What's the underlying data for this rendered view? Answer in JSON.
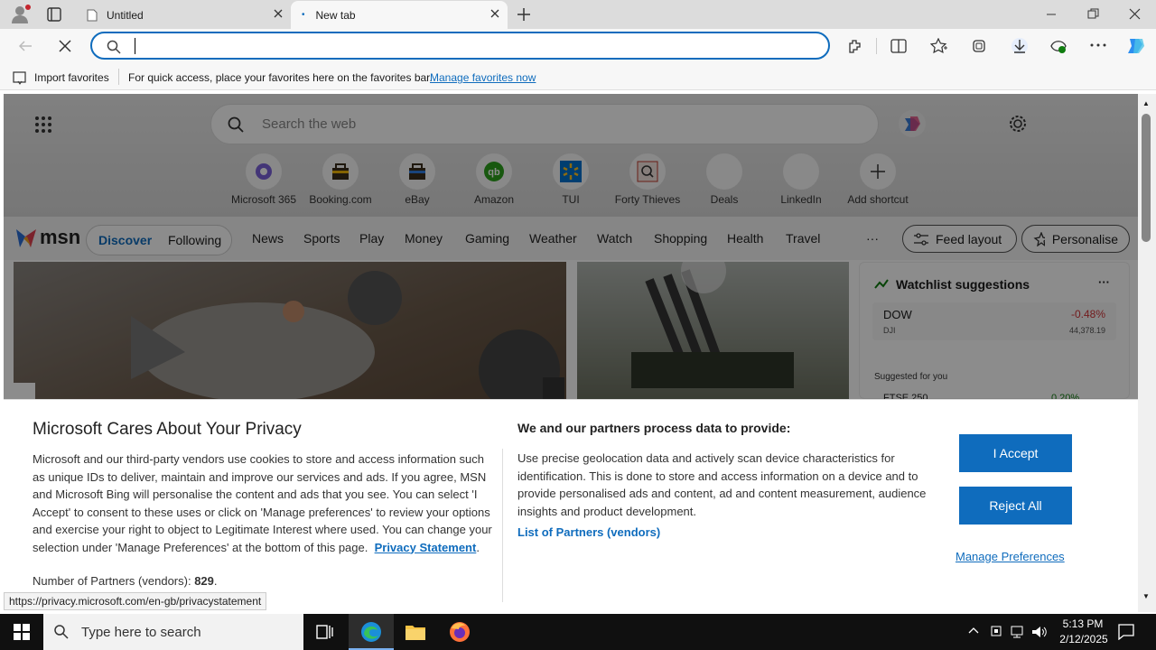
{
  "tabs": [
    {
      "label": "Untitled"
    },
    {
      "label": "New tab"
    }
  ],
  "address_bar": {
    "value": "",
    "placeholder": ""
  },
  "favorites_bar": {
    "import_label": "Import favorites",
    "message": "For quick access, place your favorites here on the favorites bar.",
    "manage_link": "Manage favorites now"
  },
  "msn": {
    "search_placeholder": "Search the web",
    "shortcuts": [
      "Microsoft 365",
      "Booking.com",
      "eBay",
      "Amazon",
      "TUI",
      "Forty Thieves",
      "Deals",
      "LinkedIn",
      "Add shortcut"
    ],
    "logo_text": "msn",
    "nav_tabs": [
      "Discover",
      "Following"
    ],
    "nav_links": [
      "News",
      "Sports",
      "Play",
      "Money",
      "Gaming",
      "Weather",
      "Watch",
      "Shopping",
      "Health",
      "Travel"
    ],
    "more_label": "···",
    "feed_layout_label": "Feed layout",
    "personalise_label": "Personalise",
    "watchlist": {
      "title": "Watchlist suggestions",
      "stock_name": "DOW",
      "stock_ticker": "DJI",
      "stock_change": "-0.48%",
      "stock_value": "44,378.19",
      "suggested_label": "Suggested for you",
      "next_stock": "FTSE 250",
      "next_change": "0.20%"
    }
  },
  "privacy": {
    "title": "Microsoft Cares About Your Privacy",
    "body": "Microsoft and our third-party vendors use cookies to store and access information such as unique IDs to deliver, maintain and improve our services and ads. If you agree, MSN and Microsoft Bing will personalise the content and ads that you see. You can select 'I Accept' to consent to these uses or click on 'Manage preferences' to review your options and exercise your right to object to Legitimate Interest where used.  You can change your selection under 'Manage Preferences' at the bottom of this page.",
    "privacy_link": "Privacy Statement",
    "partners_label": "Number of Partners (vendors):",
    "partners_count": "829",
    "process_title": "We and our partners process data to provide:",
    "process_body": "Use precise geolocation data and actively scan device characteristics for identification. This is done to store and access information on a device and to provide personalised ads and content, ad and content measurement, audience insights and product development.",
    "partners_list_link": "List of Partners (vendors)",
    "accept_label": "I Accept",
    "reject_label": "Reject All",
    "manage_label": "Manage Preferences"
  },
  "status_url": "https://privacy.microsoft.com/en-gb/privacystatement",
  "taskbar": {
    "search_placeholder": "Type here to search",
    "time": "5:13 PM",
    "date": "2/12/2025"
  },
  "colors": {
    "accent": "#0f6cbd",
    "stock_negative": "#d13438",
    "stock_positive": "#107c10"
  }
}
